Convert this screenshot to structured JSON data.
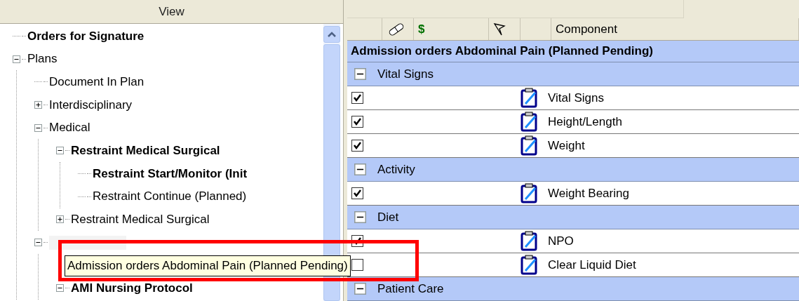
{
  "left_pane": {
    "header": "View",
    "tree": [
      {
        "label": "Orders for Signature",
        "bold": true
      },
      {
        "label": "Plans",
        "bold": false,
        "expanded": true,
        "children": [
          {
            "label": "Document In Plan",
            "bold": false
          },
          {
            "label": "Interdisciplinary",
            "bold": false,
            "expanded": false
          },
          {
            "label": "Medical",
            "bold": false,
            "expanded": true,
            "children": [
              {
                "label": "Restraint Medical Surgical",
                "bold": true,
                "expanded": true,
                "children": [
                  {
                    "label": "Restraint Start/Monitor (Init",
                    "bold": true
                  },
                  {
                    "label": "Restraint Continue (Planned)",
                    "bold": false
                  }
                ]
              },
              {
                "label": "Restraint Medical Surgical",
                "bold": false,
                "expanded": false
              }
            ]
          },
          {
            "kind": "obscured",
            "expanded": true,
            "children": [
              {
                "kind": "covered"
              },
              {
                "label": "AMI Nursing Protocol",
                "bold": true,
                "expanded": true
              }
            ]
          }
        ]
      }
    ],
    "tooltip": "Admission orders Abdominal Pain (Planned Pending)"
  },
  "orders": {
    "columns": [
      {
        "kind": "blank"
      },
      {
        "kind": "pill"
      },
      {
        "kind": "dollar",
        "label": "$"
      },
      {
        "kind": "flag"
      },
      {
        "kind": "blank"
      },
      {
        "kind": "text",
        "label": "Component"
      }
    ],
    "plan_title": "Admission orders Abdominal Pain (Planned Pending)",
    "rows": [
      {
        "kind": "group",
        "label": "Vital Signs",
        "expanded": true
      },
      {
        "kind": "order",
        "label": "Vital Signs",
        "checked": true
      },
      {
        "kind": "order",
        "label": "Height/Length",
        "checked": true
      },
      {
        "kind": "order",
        "label": "Weight",
        "checked": true
      },
      {
        "kind": "group",
        "label": "Activity",
        "expanded": true
      },
      {
        "kind": "order",
        "label": "Weight Bearing",
        "checked": true
      },
      {
        "kind": "group",
        "label": "Diet",
        "expanded": true
      },
      {
        "kind": "order",
        "label": "NPO",
        "checked": true
      },
      {
        "kind": "order",
        "label": "Clear Liquid Diet",
        "checked": false
      },
      {
        "kind": "group",
        "label": "Patient Care",
        "expanded": true
      }
    ]
  }
}
